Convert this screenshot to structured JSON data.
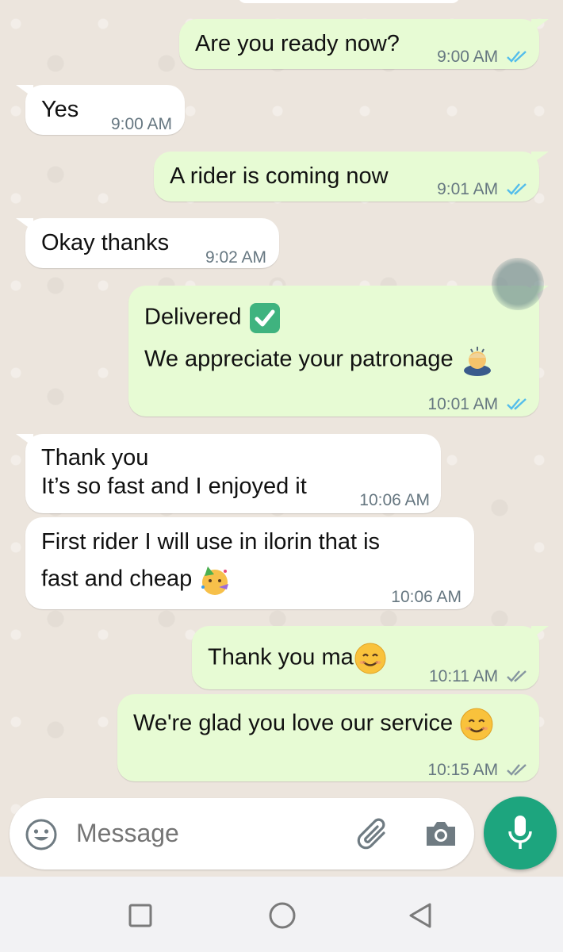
{
  "messages": [
    {
      "direction": "outgoing",
      "text": "Are you ready now?",
      "time": "9:00 AM",
      "status": "read"
    },
    {
      "direction": "incoming",
      "text": "Yes",
      "time": "9:00 AM"
    },
    {
      "direction": "outgoing",
      "text": "A rider is coming now",
      "time": "9:01 AM",
      "status": "read"
    },
    {
      "direction": "incoming",
      "text": "Okay thanks",
      "time": "9:02 AM"
    },
    {
      "direction": "outgoing",
      "line1": "Delivered",
      "line1_emoji": "check-mark-button-emoji",
      "line2": "We appreciate your patronage",
      "line2_emoji": "person-bowing-emoji",
      "time": "10:01 AM",
      "status": "read"
    },
    {
      "direction": "incoming",
      "line1": "Thank you",
      "line2": "It’s so fast and I enjoyed it",
      "time": "10:06 AM"
    },
    {
      "direction": "incoming",
      "line1": "First rider I will use in ilorin that is",
      "line2": "fast and cheap",
      "line2_emoji": "partying-face-emoji",
      "time": "10:06 AM"
    },
    {
      "direction": "outgoing",
      "text": "Thank you ma",
      "emoji": "smiling-face-emoji",
      "time": "10:11 AM",
      "status": "delivered"
    },
    {
      "direction": "outgoing",
      "text": "We're glad you love our service",
      "emoji": "smiling-face-emoji",
      "time": "10:15 AM",
      "status": "delivered"
    }
  ],
  "composer": {
    "placeholder": "Message",
    "icons": [
      "emoji-icon",
      "attach-icon",
      "camera-icon",
      "mic-icon"
    ]
  },
  "navbar": {
    "icons": [
      "recent-apps-icon",
      "home-icon",
      "back-icon"
    ]
  },
  "colors": {
    "chat_bg": "#ece5dd",
    "outgoing_bubble": "#e7fbd4",
    "incoming_bubble": "#ffffff",
    "read_tick": "#53bdeb",
    "delivered_tick": "#667781",
    "mic_button": "#1da57e"
  }
}
